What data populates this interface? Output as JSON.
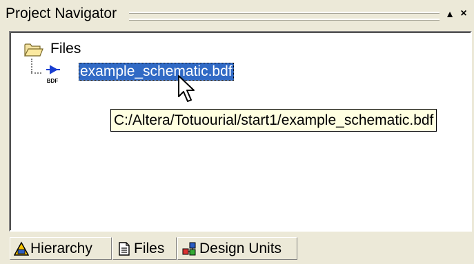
{
  "panel": {
    "title": "Project Navigator",
    "restore_icon": "▲",
    "close_icon": "×"
  },
  "tree": {
    "root_label": "Files",
    "file_label": "example_schematic.bdf",
    "file_icon_text": "BDF"
  },
  "tooltip": {
    "text": "C:/Altera/Totuourial/start1/example_schematic.bdf"
  },
  "tabs": [
    {
      "label": "Hierarchy",
      "icon": "hierarchy-warning-icon"
    },
    {
      "label": "Files",
      "icon": "files-icon"
    },
    {
      "label": "Design Units",
      "icon": "design-units-icon"
    }
  ],
  "colors": {
    "selection": "#316ac5",
    "tooltip_bg": "#ffffe1",
    "chrome": "#ece9d8"
  }
}
